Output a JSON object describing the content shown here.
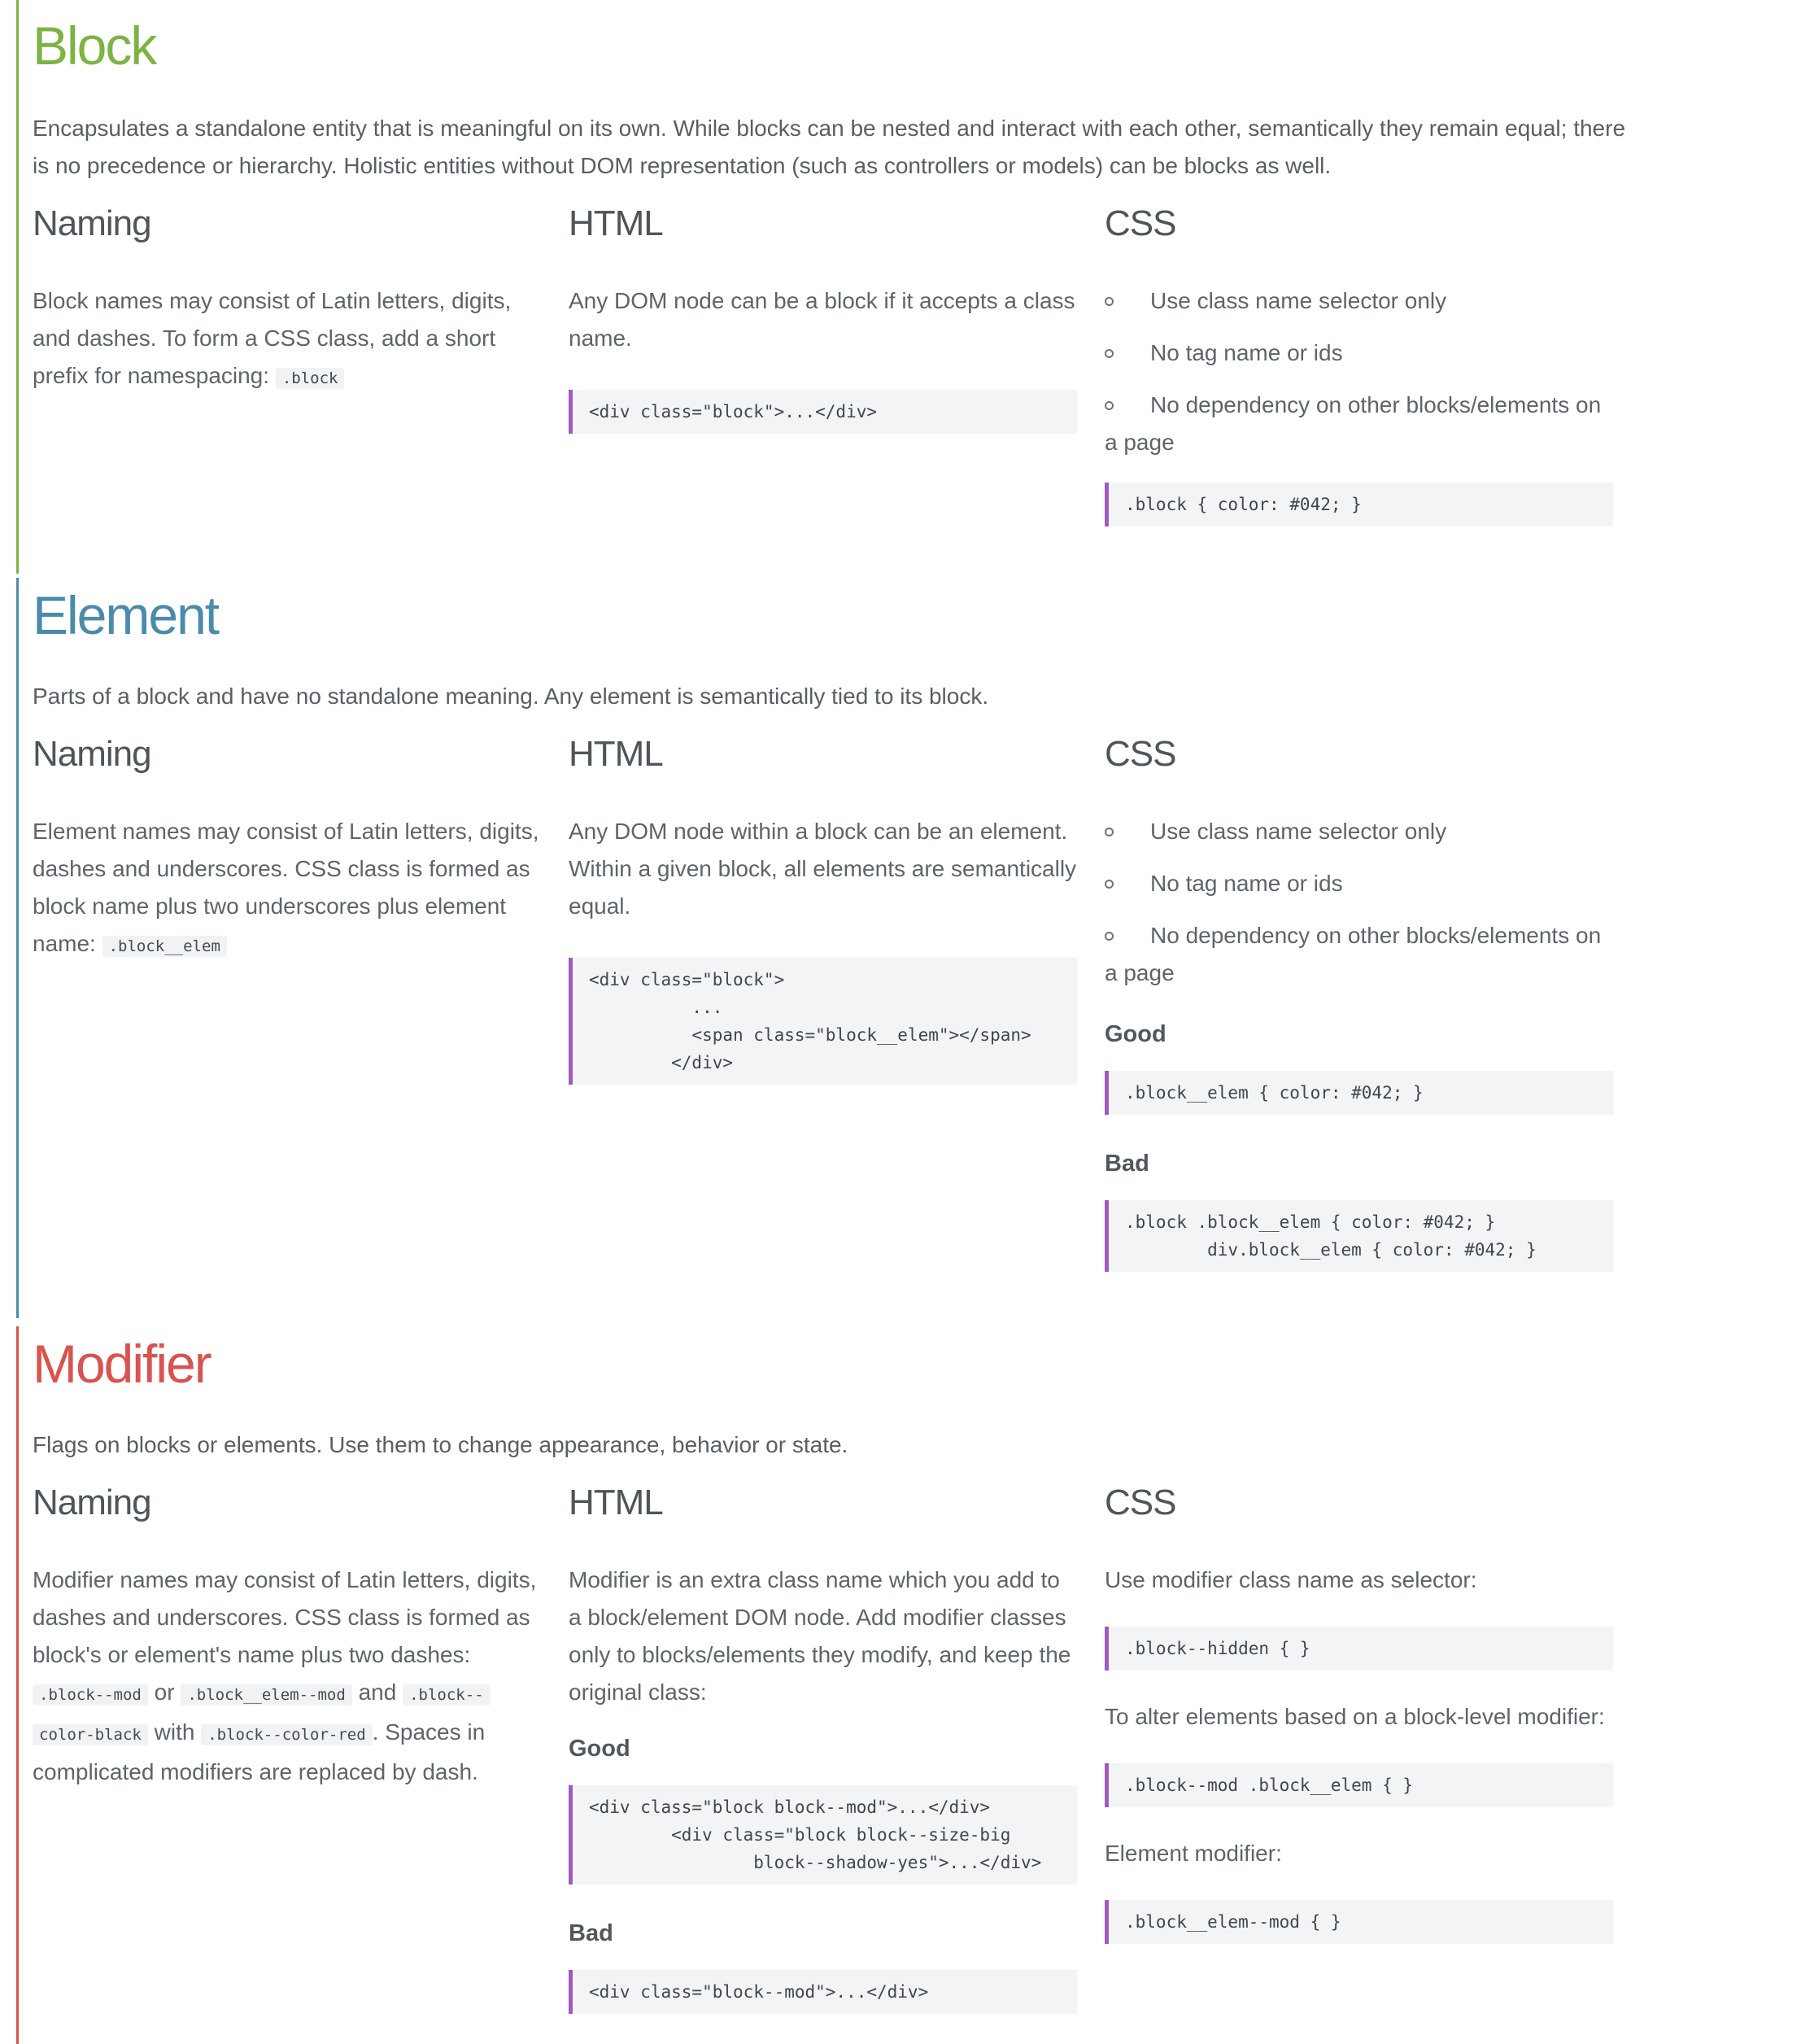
{
  "block": {
    "title": "Block",
    "color": "#7cb342",
    "description": "Encapsulates a standalone entity that is meaningful on its own. While blocks can be nested and interact with each other, semantically they remain equal; there is no precedence or hierarchy. Holistic entities without DOM representation (such as controllers or models) can be blocks as well.",
    "naming": {
      "heading": "Naming",
      "text": "Block names may consist of Latin letters, digits, and dashes. To form a CSS class, add a short prefix for namespacing:",
      "code": ".block"
    },
    "html": {
      "heading": "HTML",
      "text": "Any DOM node can be a block if it accepts a class name.",
      "code": "<div class=\"block\">...</div>"
    },
    "css": {
      "heading": "CSS",
      "bullets": [
        "Use class name selector only",
        "No tag name or ids",
        "No dependency on other blocks/elements on a page"
      ],
      "code": ".block { color: #042; }"
    }
  },
  "element": {
    "title": "Element",
    "color": "#4a8bab",
    "description": "Parts of a block and have no standalone meaning. Any element is semantically tied to its block.",
    "naming": {
      "heading": "Naming",
      "text": "Element names may consist of Latin letters, digits, dashes and underscores. CSS class is formed as block name plus two underscores plus element name:",
      "code": ".block__elem"
    },
    "html": {
      "heading": "HTML",
      "text": "Any DOM node within a block can be an element. Within a given block, all elements are semantically equal.",
      "code": "<div class=\"block\">\n          ...\n          <span class=\"block__elem\"></span>\n        </div>"
    },
    "css": {
      "heading": "CSS",
      "bullets": [
        "Use class name selector only",
        "No tag name or ids",
        "No dependency on other blocks/elements on a page"
      ],
      "good_label": "Good",
      "good_code": ".block__elem { color: #042; }",
      "bad_label": "Bad",
      "bad_code": ".block .block__elem { color: #042; }\n        div.block__elem { color: #042; }"
    }
  },
  "modifier": {
    "title": "Modifier",
    "color": "#d9534f",
    "description": "Flags on blocks or elements. Use them to change appearance, behavior or state.",
    "naming": {
      "heading": "Naming",
      "text1": "Modifier names may consist of Latin letters, digits, dashes and underscores. CSS class is formed as block's or element's name plus two dashes:",
      "code1": ".block--mod",
      "or": "or",
      "code2": ".block__elem--mod",
      "and": "and",
      "code3a": ".block--",
      "code3b": "color-black",
      "with": "with",
      "code4": ".block--color-red",
      "text2": ". Spaces in complicated modifiers are replaced by dash."
    },
    "html": {
      "heading": "HTML",
      "text": "Modifier is an extra class name which you add to a block/element DOM node. Add modifier classes only to blocks/elements they modify, and keep the original class:",
      "good_label": "Good",
      "good_code": "<div class=\"block block--mod\">...</div>\n        <div class=\"block block--size-big\n                block--shadow-yes\">...</div>",
      "bad_label": "Bad",
      "bad_code": "<div class=\"block--mod\">...</div>"
    },
    "css": {
      "heading": "CSS",
      "text1": "Use modifier class name as selector:",
      "code1": ".block--hidden { }",
      "text2": "To alter elements based on a block-level modifier:",
      "code2": ".block--mod .block__elem { }",
      "text3": "Element modifier:",
      "code3": ".block__elem--mod { }"
    }
  }
}
